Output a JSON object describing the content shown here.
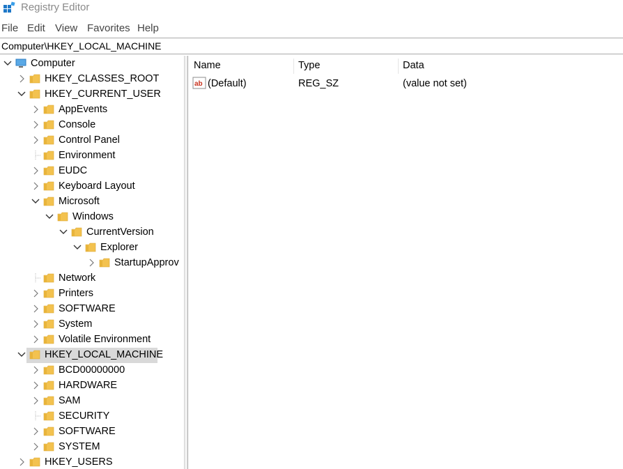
{
  "window": {
    "title": "Registry Editor"
  },
  "menu": [
    "File",
    "Edit",
    "View",
    "Favorites",
    "Help"
  ],
  "address": "Computer\\HKEY_LOCAL_MACHINE",
  "tree": [
    {
      "label": "Computer"
    },
    {
      "label": "HKEY_CLASSES_ROOT"
    },
    {
      "label": "HKEY_CURRENT_USER"
    },
    {
      "label": "AppEvents"
    },
    {
      "label": "Console"
    },
    {
      "label": "Control Panel"
    },
    {
      "label": "Environment"
    },
    {
      "label": "EUDC"
    },
    {
      "label": "Keyboard Layout"
    },
    {
      "label": "Microsoft"
    },
    {
      "label": "Windows"
    },
    {
      "label": "CurrentVersion"
    },
    {
      "label": "Explorer"
    },
    {
      "label": "StartupApprov"
    },
    {
      "label": "Network"
    },
    {
      "label": "Printers"
    },
    {
      "label": "SOFTWARE"
    },
    {
      "label": "System"
    },
    {
      "label": "Volatile Environment"
    },
    {
      "label": "HKEY_LOCAL_MACHINE"
    },
    {
      "label": "BCD00000000"
    },
    {
      "label": "HARDWARE"
    },
    {
      "label": "SAM"
    },
    {
      "label": "SECURITY"
    },
    {
      "label": "SOFTWARE"
    },
    {
      "label": "SYSTEM"
    },
    {
      "label": "HKEY_USERS"
    }
  ],
  "columns": {
    "name": "Name",
    "type": "Type",
    "data": "Data"
  },
  "values": [
    {
      "name": "(Default)",
      "type": "REG_SZ",
      "data": "(value not set)",
      "icon": "string-value-icon"
    }
  ],
  "colors": {
    "folder": "#f3c24f",
    "selection": "#d9d9d9"
  }
}
